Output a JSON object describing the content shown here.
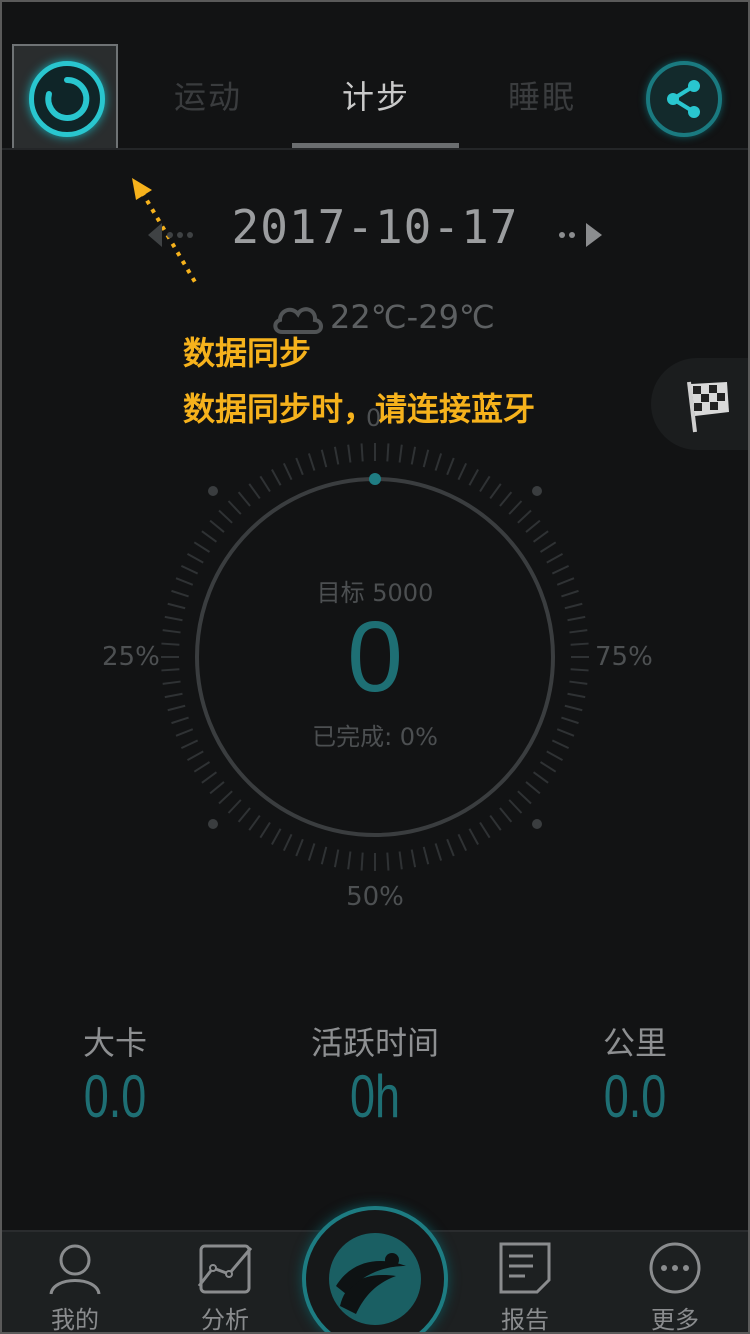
{
  "header": {
    "tabs": [
      {
        "label": "运动"
      },
      {
        "label": "计步"
      },
      {
        "label": "睡眠"
      }
    ]
  },
  "date": "2017-10-17",
  "weather": {
    "temp": "22℃-29℃",
    "icon": "cloud-icon"
  },
  "tooltip": {
    "title": "数据同步",
    "message": "数据同步时，请连接蓝牙"
  },
  "dial": {
    "label_top": "0",
    "label_left": "25%",
    "label_right": "75%",
    "label_bottom": "50%",
    "goal": "目标 5000",
    "steps": "0",
    "completed": "已完成: 0%",
    "progress": 0
  },
  "stats": [
    {
      "label": "大卡",
      "value": "0.0"
    },
    {
      "label": "活跃时间",
      "value": "0h"
    },
    {
      "label": "公里",
      "value": "0.0"
    }
  ],
  "nav": [
    {
      "label": "我的",
      "icon": "user-icon"
    },
    {
      "label": "分析",
      "icon": "chart-icon"
    },
    {
      "label": "",
      "icon": "app-logo-icon"
    },
    {
      "label": "报告",
      "icon": "report-icon"
    },
    {
      "label": "更多",
      "icon": "more-icon"
    }
  ],
  "colors": {
    "accent": "#29c6cf",
    "tooltip": "#f6b21c",
    "background": "#121314"
  }
}
